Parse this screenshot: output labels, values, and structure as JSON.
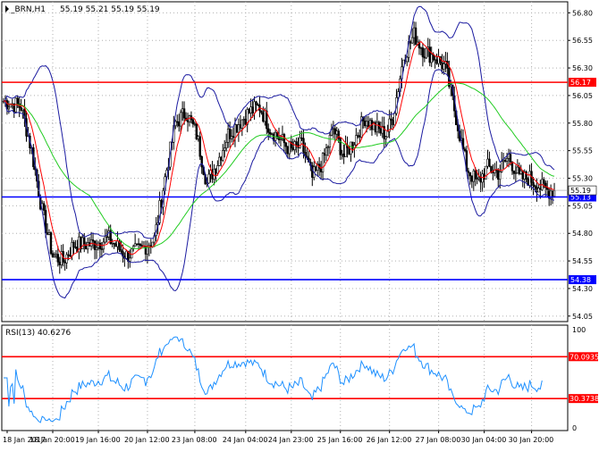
{
  "chart_data": [
    {
      "type": "candlestick",
      "symbol_label": "_BRN,H1",
      "ohlc_header": "55.19 55.21 55.19 55.19",
      "ylim": [
        54.0,
        56.9
      ],
      "y_ticks": [
        "56.80",
        "56.55",
        "56.30",
        "56.05",
        "55.80",
        "55.55",
        "55.30",
        "55.05",
        "54.80",
        "54.55",
        "54.30",
        "54.05"
      ],
      "x_tick_labels": [
        "18 Jan 2017",
        "18 Jan 20:00",
        "19 Jan 16:00",
        "20 Jan 12:00",
        "23 Jan 08:00",
        "24 Jan 04:00",
        "24 Jan 23:00",
        "25 Jan 16:00",
        "26 Jan 12:00",
        "27 Jan 08:00",
        "30 Jan 04:00",
        "30 Jan 20:00"
      ],
      "horizontal_levels": [
        {
          "value": 56.17,
          "label": "56.17",
          "color": "#ff0000"
        },
        {
          "value": 55.13,
          "label": "55.13",
          "color": "#0000ff"
        },
        {
          "value": 54.38,
          "label": "54.38",
          "color": "#0000ff"
        }
      ],
      "current_price": {
        "value": 55.19,
        "label": "55.19"
      },
      "price_path": [
        {
          "i": 0,
          "p": 56.0
        },
        {
          "i": 10,
          "p": 55.95
        },
        {
          "i": 16,
          "p": 55.55
        },
        {
          "i": 22,
          "p": 55.0
        },
        {
          "i": 28,
          "p": 54.6
        },
        {
          "i": 34,
          "p": 54.55
        },
        {
          "i": 40,
          "p": 54.7
        },
        {
          "i": 50,
          "p": 54.7
        },
        {
          "i": 60,
          "p": 54.75
        },
        {
          "i": 70,
          "p": 54.6
        },
        {
          "i": 78,
          "p": 54.65
        },
        {
          "i": 86,
          "p": 54.75
        },
        {
          "i": 92,
          "p": 55.3
        },
        {
          "i": 98,
          "p": 55.8
        },
        {
          "i": 104,
          "p": 55.9
        },
        {
          "i": 110,
          "p": 55.7
        },
        {
          "i": 116,
          "p": 55.25
        },
        {
          "i": 122,
          "p": 55.45
        },
        {
          "i": 128,
          "p": 55.7
        },
        {
          "i": 134,
          "p": 55.8
        },
        {
          "i": 140,
          "p": 55.9
        },
        {
          "i": 146,
          "p": 55.95
        },
        {
          "i": 152,
          "p": 55.75
        },
        {
          "i": 158,
          "p": 55.65
        },
        {
          "i": 164,
          "p": 55.55
        },
        {
          "i": 170,
          "p": 55.6
        },
        {
          "i": 176,
          "p": 55.3
        },
        {
          "i": 182,
          "p": 55.45
        },
        {
          "i": 188,
          "p": 55.75
        },
        {
          "i": 194,
          "p": 55.5
        },
        {
          "i": 200,
          "p": 55.65
        },
        {
          "i": 206,
          "p": 55.85
        },
        {
          "i": 212,
          "p": 55.75
        },
        {
          "i": 218,
          "p": 55.7
        },
        {
          "i": 222,
          "p": 55.85
        },
        {
          "i": 228,
          "p": 56.4
        },
        {
          "i": 234,
          "p": 56.6
        },
        {
          "i": 240,
          "p": 56.45
        },
        {
          "i": 246,
          "p": 56.4
        },
        {
          "i": 252,
          "p": 56.3
        },
        {
          "i": 256,
          "p": 56.0
        },
        {
          "i": 260,
          "p": 55.7
        },
        {
          "i": 264,
          "p": 55.4
        },
        {
          "i": 270,
          "p": 55.25
        },
        {
          "i": 276,
          "p": 55.4
        },
        {
          "i": 282,
          "p": 55.35
        },
        {
          "i": 288,
          "p": 55.5
        },
        {
          "i": 294,
          "p": 55.3
        },
        {
          "i": 300,
          "p": 55.3
        },
        {
          "i": 306,
          "p": 55.22
        },
        {
          "i": 310,
          "p": 55.19
        }
      ],
      "indicators": [
        "Bollinger Bands (blue)",
        "MA fast (red)",
        "MA slow (green)"
      ]
    },
    {
      "type": "line",
      "label": "RSI(13) 40.6276",
      "ylim": [
        0,
        100
      ],
      "levels": [
        {
          "value": 70.0935,
          "label": "70.0935",
          "color": "#ff0000"
        },
        {
          "value": 30.3738,
          "label": "30.3738",
          "color": "#ff0000"
        }
      ],
      "y_ticks": [
        "100",
        "0"
      ],
      "line_color": "#1e90ff"
    }
  ]
}
